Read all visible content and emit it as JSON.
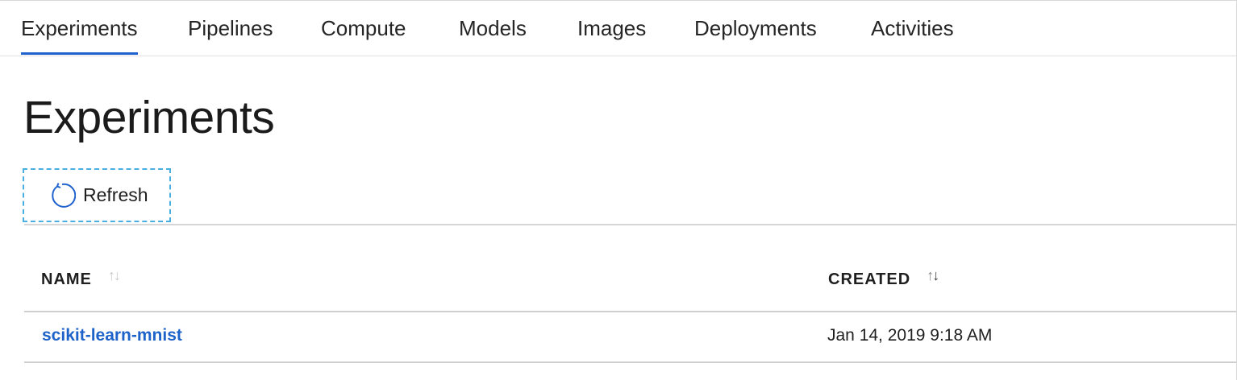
{
  "tabs": [
    {
      "label": "Experiments",
      "active": true
    },
    {
      "label": "Pipelines",
      "active": false
    },
    {
      "label": "Compute",
      "active": false
    },
    {
      "label": "Models",
      "active": false
    },
    {
      "label": "Images",
      "active": false
    },
    {
      "label": "Deployments",
      "active": false
    },
    {
      "label": "Activities",
      "active": false
    }
  ],
  "page": {
    "title": "Experiments"
  },
  "toolbar": {
    "refresh_label": "Refresh",
    "refresh_icon": "refresh-icon"
  },
  "table": {
    "columns": [
      {
        "label": "NAME",
        "sort_icon": "sort-icon"
      },
      {
        "label": "CREATED",
        "sort_icon": "sort-icon"
      }
    ],
    "rows": [
      {
        "name": "scikit-learn-mnist",
        "created": "Jan 14, 2019 9:18 AM"
      }
    ]
  },
  "colors": {
    "accent": "#1f62cd",
    "link": "#1e63c9",
    "focus_outline": "#49aee2"
  }
}
